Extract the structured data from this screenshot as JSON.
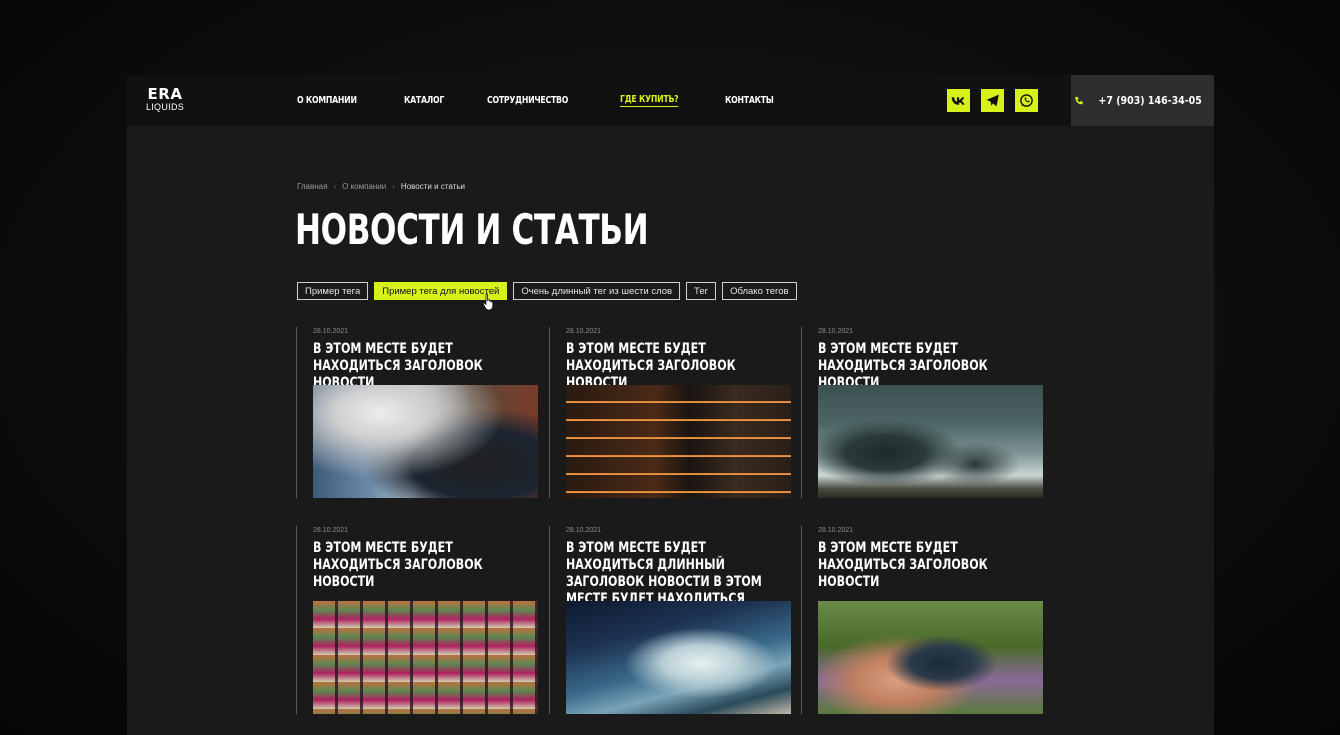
{
  "logo": {
    "line1": "ERA",
    "line2": "LIQUIDS"
  },
  "nav": [
    {
      "label": "О КОМПАНИИ"
    },
    {
      "label": "КАТАЛОГ"
    },
    {
      "label": "СОТРУДНИЧЕСТВО"
    },
    {
      "label": "ГДЕ КУПИТЬ?",
      "active": true
    },
    {
      "label": "КОНТАКТЫ"
    }
  ],
  "socials": [
    "vk-icon",
    "telegram-icon",
    "whatsapp-icon"
  ],
  "phone": "+7 (903) 146-34-05",
  "breadcrumb": {
    "home": "Главная",
    "section": "О компании",
    "current": "Новости и статьи"
  },
  "page_title": "НОВОСТИ И СТАТЬИ",
  "tags": [
    {
      "label": "Пример тега"
    },
    {
      "label": "Пример тега для новостей",
      "active": true
    },
    {
      "label": "Очень длинный тег из шести слов"
    },
    {
      "label": "Тег"
    },
    {
      "label": "Облако тегов"
    }
  ],
  "cards": [
    {
      "date": "28.10.2021",
      "title": "В ЭТОМ МЕСТЕ БУДЕТ НАХОДИТЬСЯ ЗАГОЛОВОК НОВОСТИ",
      "image": "vape-smoke-photo"
    },
    {
      "date": "28.10.2021",
      "title": "В ЭТОМ МЕСТЕ БУДЕТ НАХОДИТЬСЯ ЗАГОЛОВОК НОВОСТИ",
      "image": "shop-shelves-photo"
    },
    {
      "date": "28.10.2021",
      "title": "В ЭТОМ МЕСТЕ БУДЕТ НАХОДИТЬСЯ ЗАГОЛОВОК НОВОСТИ",
      "image": "tornado-photo"
    },
    {
      "date": "28.10.2021",
      "title": "В ЭТОМ МЕСТЕ БУДЕТ НАХОДИТЬСЯ ЗАГОЛОВОК НОВОСТИ",
      "image": "store-interior-photo"
    },
    {
      "date": "28.10.2021",
      "title": "В ЭТОМ МЕСТЕ БУДЕТ НАХОДИТЬСЯ ДЛИННЫЙ ЗАГОЛОВОК НОВОСТИ В ЭТОМ МЕСТЕ БУДЕТ НАХОДИТЬСЯ",
      "image": "ocean-wave-photo"
    },
    {
      "date": "28.10.2021",
      "title": "В ЭТОМ МЕСТЕ БУДЕТ НАХОДИТЬСЯ ЗАГОЛОВОК НОВОСТИ",
      "image": "liquid-bottles-photo"
    }
  ],
  "colors": {
    "accent": "#d6f21a",
    "background": "#1a1a1a",
    "header": "#111111",
    "phone_box": "#2e2e2e"
  }
}
